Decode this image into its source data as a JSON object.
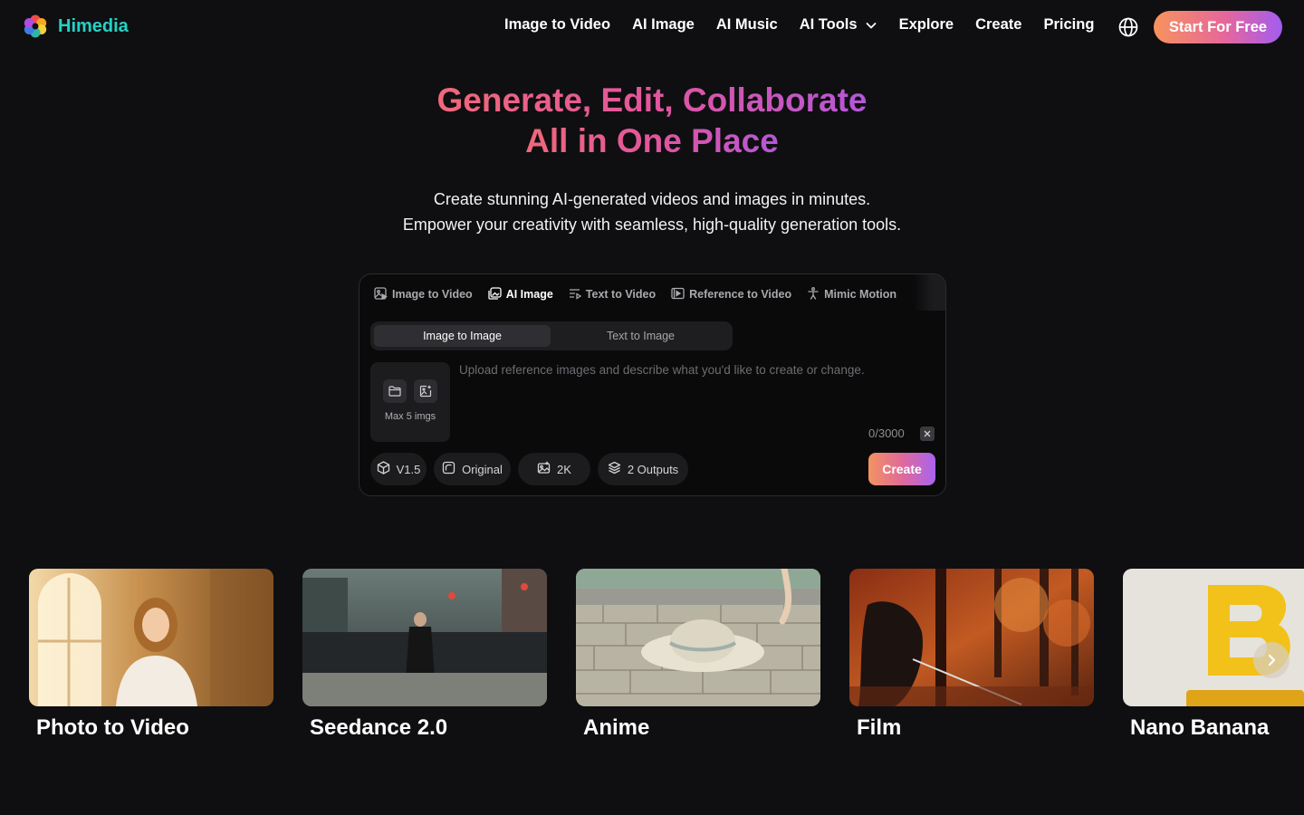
{
  "header": {
    "brand": "Himedia",
    "nav": [
      "Image to Video",
      "AI Image",
      "AI Music",
      "AI Tools",
      "Explore",
      "Create",
      "Pricing"
    ],
    "cta": "Start For Free",
    "icons": {
      "logo": "flower-logo",
      "globe": "globe-icon",
      "dropdown": "chevron-down-icon"
    }
  },
  "hero": {
    "title_line1": "Generate, Edit, Collaborate",
    "title_line2": "All in One Place",
    "subtitle_line1": "Create stunning AI-generated videos and images in minutes.",
    "subtitle_line2": "Empower your creativity with seamless, high-quality generation tools."
  },
  "panel": {
    "tabs": [
      {
        "label": "Image to Video",
        "icon": "image-video-icon",
        "active": false
      },
      {
        "label": "AI Image",
        "icon": "ai-image-icon",
        "active": true
      },
      {
        "label": "Text to Video",
        "icon": "text-video-icon",
        "active": false
      },
      {
        "label": "Reference to Video",
        "icon": "reference-video-icon",
        "active": false
      },
      {
        "label": "Mimic Motion",
        "icon": "person-motion-icon",
        "active": false
      }
    ],
    "modes": [
      "Image to Image",
      "Text to Image"
    ],
    "active_mode": "Image to Image",
    "upload_label": "Max 5 imgs",
    "prompt_placeholder": "Upload reference images and describe what you'd like to create or change.",
    "prompt_value": "",
    "counter": "0/3000",
    "chips": {
      "model": "V1.5",
      "ratio": "Original",
      "resolution": "2K",
      "outputs": "2 Outputs"
    },
    "create_label": "Create"
  },
  "cards": [
    {
      "title": "Photo to Video"
    },
    {
      "title": "Seedance 2.0"
    },
    {
      "title": "Anime"
    },
    {
      "title": "Film"
    },
    {
      "title": "Nano Banana"
    }
  ],
  "colors": {
    "brand": "#22d3c5",
    "background": "#0f0f11",
    "gradient_start": "#f7935e",
    "gradient_mid": "#e6679a",
    "gradient_end": "#a35cf0"
  }
}
